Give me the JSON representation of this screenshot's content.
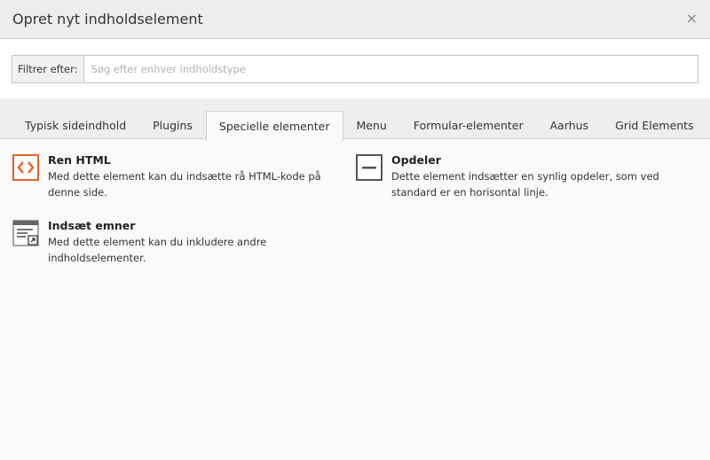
{
  "modal": {
    "title": "Opret nyt indholdselement",
    "close_symbol": "×"
  },
  "filter": {
    "label": "Filtrer efter:",
    "value": "",
    "placeholder": "Søg efter enhver indholdstype"
  },
  "tabs": [
    {
      "label": "Typisk sideindhold",
      "active": false
    },
    {
      "label": "Plugins",
      "active": false
    },
    {
      "label": "Specielle elementer",
      "active": true
    },
    {
      "label": "Menu",
      "active": false
    },
    {
      "label": "Formular-elementer",
      "active": false
    },
    {
      "label": "Aarhus",
      "active": false
    },
    {
      "label": "Grid Elements",
      "active": false
    }
  ],
  "items": [
    {
      "icon": "html-code-icon",
      "title": "Ren HTML",
      "description": "Med dette element kan du indsætte rå HTML-kode på denne side."
    },
    {
      "icon": "divider-icon",
      "title": "Opdeler",
      "description": "Dette element indsætter en synlig opdeler, som ved standard er en horisontal linje."
    },
    {
      "icon": "insert-records-icon",
      "title": "Indsæt emner",
      "description": "Med dette element kan du inkludere andre indholdselementer."
    }
  ],
  "colors": {
    "html_icon_accent": "#e5622a",
    "icon_dark": "#555555"
  }
}
